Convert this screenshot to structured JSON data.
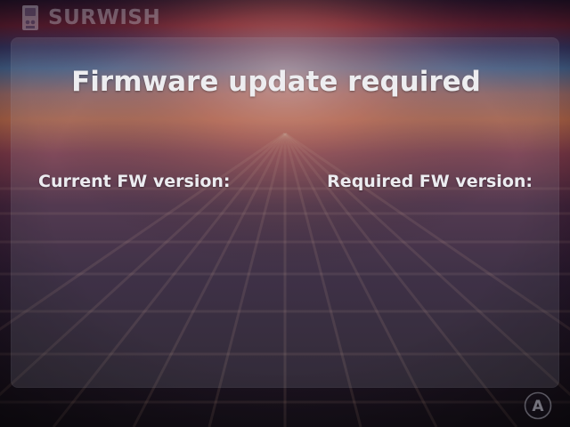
{
  "header": {
    "app_name": "SURWISH",
    "logo_icon": "nintendo-switch-cartridge-icon"
  },
  "dialog": {
    "title": "Firmware update required",
    "current_fw_label": "Current FW version:",
    "required_fw_label": "Required FW version:"
  },
  "controls": {
    "confirm_button_glyph": "A",
    "confirm_button_icon": "a-button-icon"
  },
  "colors": {
    "text": "#ececf0",
    "panel": "rgba(165,165,185,0.17)",
    "background_sky_dark": "#1a1228",
    "background_horizon": "#b05a4a"
  }
}
